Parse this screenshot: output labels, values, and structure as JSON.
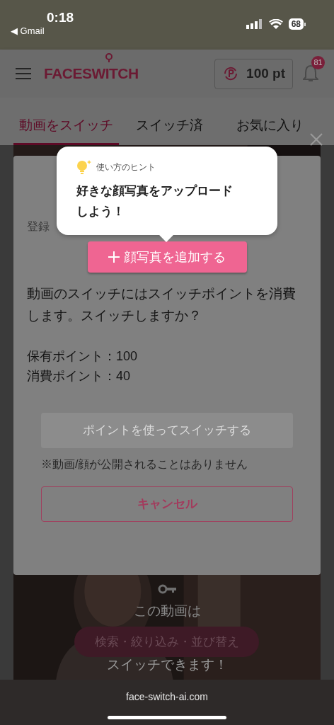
{
  "status_bar": {
    "time": "0:18",
    "back_app": "◀ Gmail",
    "battery": "68"
  },
  "header": {
    "logo": "FACESWITCH",
    "points": "100 pt",
    "notification_count": "81"
  },
  "tabs": [
    {
      "label": "動画をスイッチ",
      "selected": true
    },
    {
      "label": "スイッチ済",
      "selected": false
    },
    {
      "label": "お気に入り",
      "selected": false
    }
  ],
  "dialog": {
    "label": "登録",
    "add_photo_button": "顔写真を追加する",
    "message": "動画のスイッチにはスイッチポイントを消費します。スイッチしますか？",
    "held_points": "保有ポイント：100",
    "used_points": "消費ポイント：40",
    "switch_button": {
      "label": "ポイントを使ってスイッチする",
      "disabled": true
    },
    "note": "※動画/顔が公開されることはありません",
    "cancel_button": "キャンセル"
  },
  "tooltip": {
    "heading": "使い方のヒント",
    "text": "好きな顔写真をアップロードしよう！"
  },
  "video": {
    "lines": [
      "この動画は",
      "スイッチできます！"
    ]
  },
  "filter_button": "検索・絞り込み・並び替え",
  "browser": {
    "url": "face-switch-ai.com"
  }
}
